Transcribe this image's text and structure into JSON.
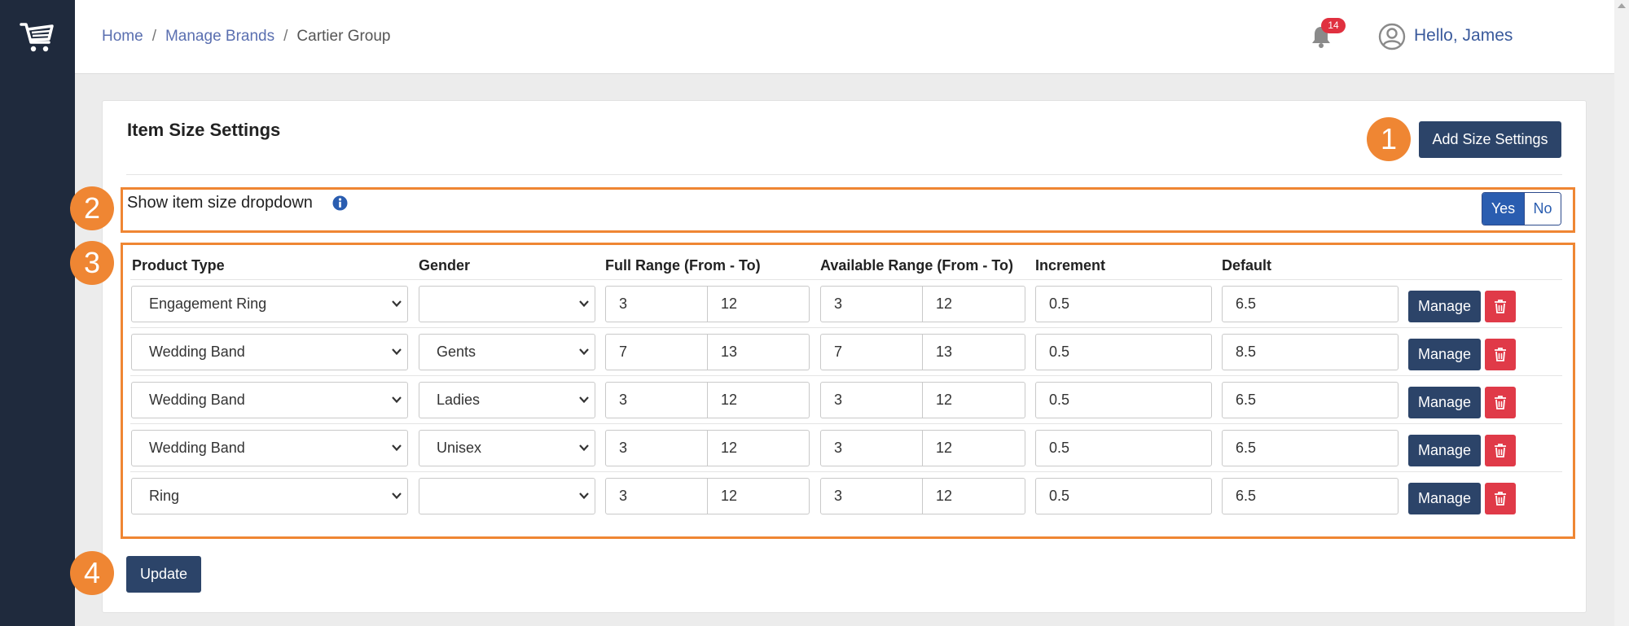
{
  "header": {
    "breadcrumb": [
      "Home",
      "Manage Brands",
      "Cartier Group"
    ],
    "notification_count": "14",
    "greeting": "Hello, James"
  },
  "panel": {
    "title": "Item Size Settings",
    "add_button": "Add Size Settings",
    "toggle": {
      "label": "Show item size dropdown",
      "yes": "Yes",
      "no": "No",
      "selected": "Yes"
    },
    "columns": [
      "Product Type",
      "Gender",
      "Full Range (From - To)",
      "Available Range (From - To)",
      "Increment",
      "Default"
    ],
    "rows": [
      {
        "product_type": "Engagement Ring",
        "gender": "",
        "full_from": "3",
        "full_to": "12",
        "avail_from": "3",
        "avail_to": "12",
        "increment": "0.5",
        "default": "6.5",
        "manage": "Manage"
      },
      {
        "product_type": "Wedding Band",
        "gender": "Gents",
        "full_from": "7",
        "full_to": "13",
        "avail_from": "7",
        "avail_to": "13",
        "increment": "0.5",
        "default": "8.5",
        "manage": "Manage"
      },
      {
        "product_type": "Wedding Band",
        "gender": "Ladies",
        "full_from": "3",
        "full_to": "12",
        "avail_from": "3",
        "avail_to": "12",
        "increment": "0.5",
        "default": "6.5",
        "manage": "Manage"
      },
      {
        "product_type": "Wedding Band",
        "gender": "Unisex",
        "full_from": "3",
        "full_to": "12",
        "avail_from": "3",
        "avail_to": "12",
        "increment": "0.5",
        "default": "6.5",
        "manage": "Manage"
      },
      {
        "product_type": "Ring",
        "gender": "",
        "full_from": "3",
        "full_to": "12",
        "avail_from": "3",
        "avail_to": "12",
        "increment": "0.5",
        "default": "6.5",
        "manage": "Manage"
      }
    ],
    "update_button": "Update"
  },
  "callouts": [
    "1",
    "2",
    "3",
    "4"
  ],
  "colors": {
    "sidebar": "#1f2a3d",
    "primary_button": "#2c4469",
    "toggle_active": "#2a5db0",
    "delete": "#e03a48",
    "highlight": "#ef8633",
    "badge": "#e0303f"
  },
  "icons": [
    "cart-logo-icon",
    "bell-icon",
    "user-circle-icon",
    "info-icon",
    "chevron-down-icon",
    "trash-icon"
  ]
}
